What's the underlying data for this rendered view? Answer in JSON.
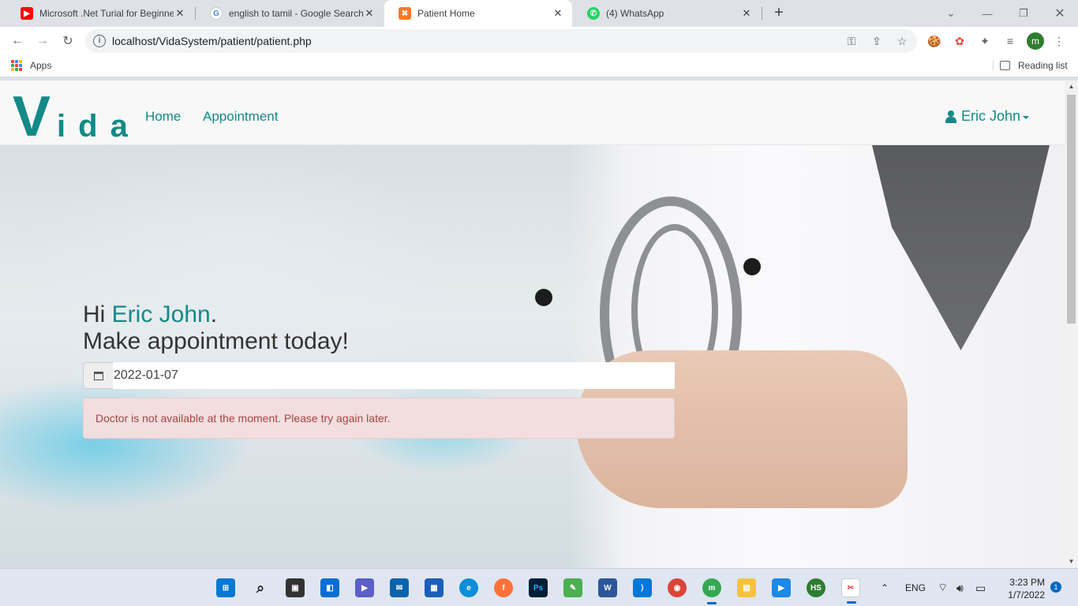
{
  "browser": {
    "tabs": [
      {
        "title": "Microsoft .Net Turial for Beginne",
        "favicon": "youtube-icon",
        "color": "#ff0000"
      },
      {
        "title": "english to tamil - Google Search",
        "favicon": "google-icon",
        "color": "#4285f4"
      },
      {
        "title": "Patient Home",
        "favicon": "xampp-icon",
        "color": "#fb7a24"
      },
      {
        "title": "(4) WhatsApp",
        "favicon": "whatsapp-icon",
        "color": "#25d366"
      }
    ],
    "active_tab": 2,
    "url": "localhost/VidaSystem/patient/patient.php",
    "profile_initial": "m",
    "bookmarks": {
      "apps_label": "Apps",
      "reading_list_label": "Reading list"
    }
  },
  "site": {
    "brand_big": "V",
    "brand_rest": "ida",
    "nav": {
      "home": "Home",
      "appointment": "Appointment"
    },
    "user_name": "Eric John"
  },
  "hero": {
    "greeting_prefix": "Hi ",
    "patient_name": "Eric John",
    "greeting_suffix": ".",
    "subtitle": "Make appointment today!",
    "date_value": "2022-01-07",
    "alert_text": "Doctor is not available at the moment. Please try again later."
  },
  "taskbar": {
    "language": "ENG",
    "time": "3:23 PM",
    "date": "1/7/2022",
    "notifications": "1"
  }
}
